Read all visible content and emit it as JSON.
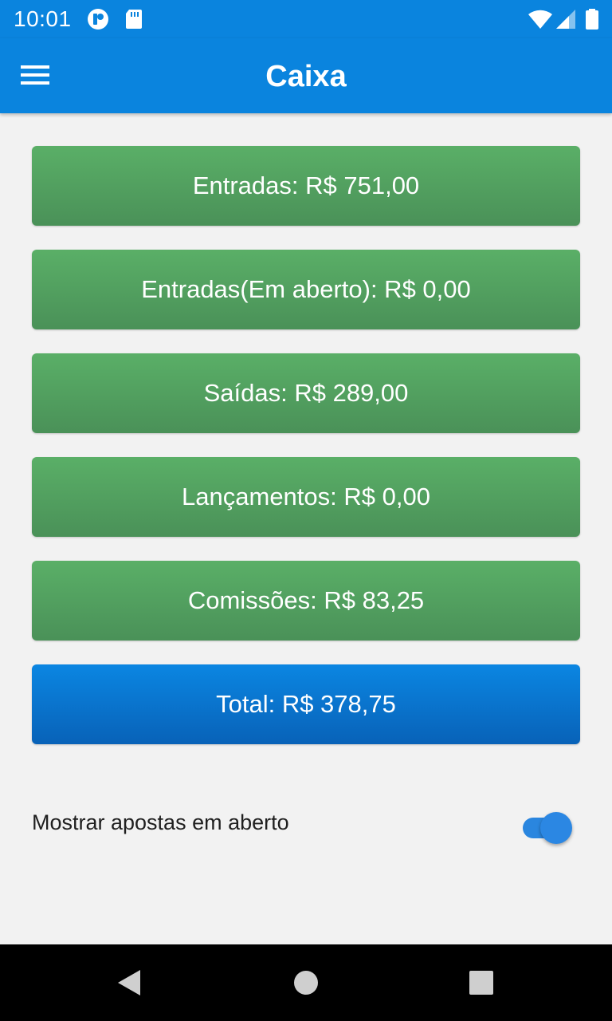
{
  "status_bar": {
    "time": "10:01",
    "icons": [
      "notification-app-icon",
      "sd-card-icon",
      "wifi-icon",
      "cell-signal-icon",
      "battery-icon"
    ]
  },
  "app_bar": {
    "title": "Caixa",
    "menu_icon": "hamburger-menu-icon"
  },
  "summary": {
    "entradas": "Entradas: R$ 751,00",
    "entradas_em_aberto": "Entradas(Em aberto): R$ 0,00",
    "saidas": "Saídas: R$ 289,00",
    "lancamentos": "Lançamentos: R$ 0,00",
    "comissoes": "Comissões: R$ 83,25",
    "total": "Total: R$ 378,75"
  },
  "toggle": {
    "label": "Mostrar apostas em aberto",
    "checked": true
  },
  "colors": {
    "primary": "#0a84de",
    "card_green": "#52a061",
    "card_blue": "#0a74cf",
    "background": "#f2f2f2"
  },
  "nav_bar": {
    "icons": [
      "back-icon",
      "home-icon",
      "recents-icon"
    ]
  }
}
